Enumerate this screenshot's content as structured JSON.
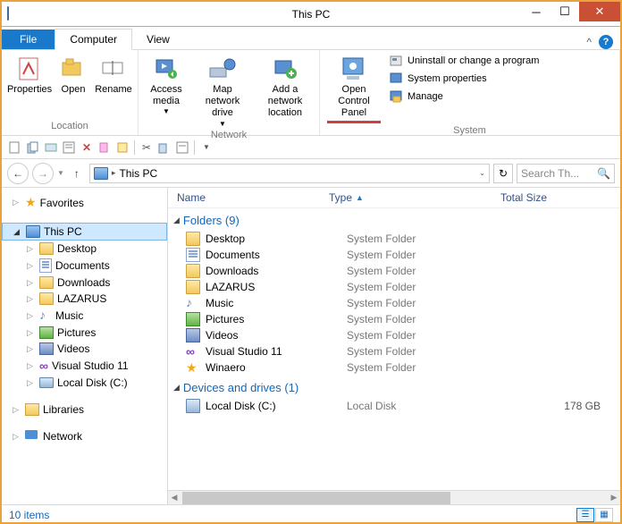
{
  "window": {
    "title": "This PC"
  },
  "tabs": {
    "file": "File",
    "computer": "Computer",
    "view": "View"
  },
  "ribbon": {
    "location": {
      "label": "Location",
      "properties": "Properties",
      "open": "Open",
      "rename": "Rename"
    },
    "network": {
      "label": "Network",
      "access_media": "Access media",
      "map_drive": "Map network drive",
      "add_location": "Add a network location"
    },
    "system": {
      "label": "System",
      "open_cpl": "Open Control Panel",
      "uninstall": "Uninstall or change a program",
      "sys_props": "System properties",
      "manage": "Manage"
    }
  },
  "address": {
    "location": "This PC"
  },
  "search": {
    "placeholder": "Search Th..."
  },
  "columns": {
    "name": "Name",
    "type": "Type",
    "total_size": "Total Size"
  },
  "groups": {
    "folders": {
      "title": "Folders (9)"
    },
    "devices": {
      "title": "Devices and drives (1)"
    }
  },
  "folders": [
    {
      "name": "Desktop",
      "type": "System Folder",
      "icon": "desktop"
    },
    {
      "name": "Documents",
      "type": "System Folder",
      "icon": "documents"
    },
    {
      "name": "Downloads",
      "type": "System Folder",
      "icon": "downloads"
    },
    {
      "name": "LAZARUS",
      "type": "System Folder",
      "icon": "folder"
    },
    {
      "name": "Music",
      "type": "System Folder",
      "icon": "music"
    },
    {
      "name": "Pictures",
      "type": "System Folder",
      "icon": "pictures"
    },
    {
      "name": "Videos",
      "type": "System Folder",
      "icon": "videos"
    },
    {
      "name": "Visual Studio 11",
      "type": "System Folder",
      "icon": "vs"
    },
    {
      "name": "Winaero",
      "type": "System Folder",
      "icon": "star"
    }
  ],
  "drives": [
    {
      "name": "Local Disk (C:)",
      "type": "Local Disk",
      "size": "178 GB"
    }
  ],
  "nav": {
    "favorites": "Favorites",
    "this_pc": "This PC",
    "children": [
      "Desktop",
      "Documents",
      "Downloads",
      "LAZARUS",
      "Music",
      "Pictures",
      "Videos",
      "Visual Studio 11",
      "Local Disk (C:)"
    ],
    "libraries": "Libraries",
    "network": "Network"
  },
  "status": {
    "count": "10 items"
  }
}
